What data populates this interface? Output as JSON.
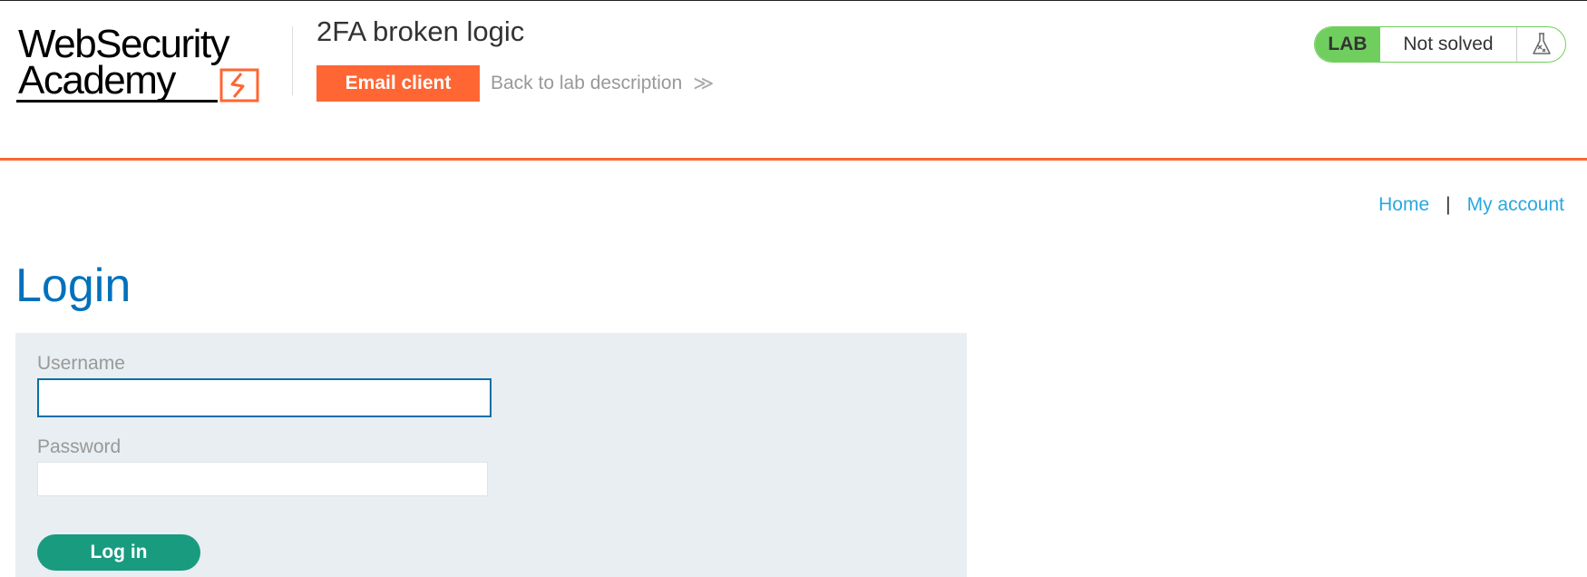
{
  "header": {
    "logo": {
      "line1": "WebSecurity",
      "line2": "Academy"
    },
    "lab_title": "2FA broken logic",
    "email_client_label": "Email client",
    "back_link_label": "Back to lab description",
    "back_chevron": "≫",
    "status_badge": {
      "lab_label": "LAB",
      "status": "Not solved",
      "icon": "flask-icon"
    }
  },
  "nav": {
    "home": "Home",
    "separator": "|",
    "my_account": "My account"
  },
  "login": {
    "title": "Login",
    "username_label": "Username",
    "username_value": "",
    "password_label": "Password",
    "password_value": "",
    "submit_label": "Log in"
  },
  "colors": {
    "brand_orange": "#ff6633",
    "lab_green": "#70ce5e",
    "title_blue": "#0071bc",
    "link_blue": "#29a8e0",
    "button_teal": "#199b80",
    "panel_bg": "#e8eef1"
  }
}
